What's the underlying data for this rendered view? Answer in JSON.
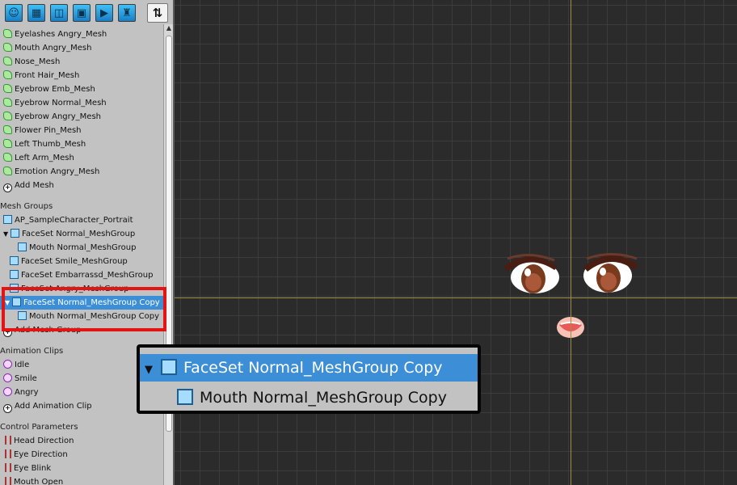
{
  "toolbar": {
    "buttons": [
      {
        "icon": "avatar-icon"
      },
      {
        "icon": "mesh-layout-icon"
      },
      {
        "icon": "mesh-icon"
      },
      {
        "icon": "meshgroup-icon"
      },
      {
        "icon": "play-animation-icon"
      },
      {
        "icon": "control-param-icon"
      },
      {
        "icon": "sort-icon",
        "label": "⇅"
      }
    ]
  },
  "hierarchy": {
    "meshes": [
      "Eyelashes Angry_Mesh",
      "Mouth Angry_Mesh",
      "Nose_Mesh",
      "Front Hair_Mesh",
      "Eyebrow Emb_Mesh",
      "Eyebrow Normal_Mesh",
      "Eyebrow Angry_Mesh",
      "Flower Pin_Mesh",
      "Left Thumb_Mesh",
      "Left Arm_Mesh",
      "Emotion Angry_Mesh"
    ],
    "add_mesh": "Add Mesh",
    "mesh_groups_header": "Mesh Groups",
    "mesh_groups": [
      "AP_SampleCharacter_Portrait",
      "FaceSet Normal_MeshGroup",
      "Mouth Normal_MeshGroup",
      "FaceSet Smile_MeshGroup",
      "FaceSet Embarrassd_MeshGroup",
      "FaceSet Angry_MeshGroup",
      "FaceSet Normal_MeshGroup Copy",
      "Mouth Normal_MeshGroup Copy"
    ],
    "add_mesh_group": "Add Mesh Group",
    "animation_clips_header": "Animation Clips",
    "animation_clips": [
      "Idle",
      "Smile",
      "Angry"
    ],
    "add_animation_clip": "Add Animation Clip",
    "control_parameters_header": "Control Parameters",
    "control_parameters": [
      "Head Direction",
      "Eye Direction",
      "Eye Blink",
      "Mouth Open"
    ]
  },
  "zoom": {
    "selected": "FaceSet Normal_MeshGroup Copy",
    "child": "Mouth Normal_MeshGroup Copy"
  },
  "colors": {
    "selection": "#3c8ed6",
    "highlight": "#e51414",
    "grid_bg": "#2b2b2b",
    "axis": "#a08e46"
  }
}
